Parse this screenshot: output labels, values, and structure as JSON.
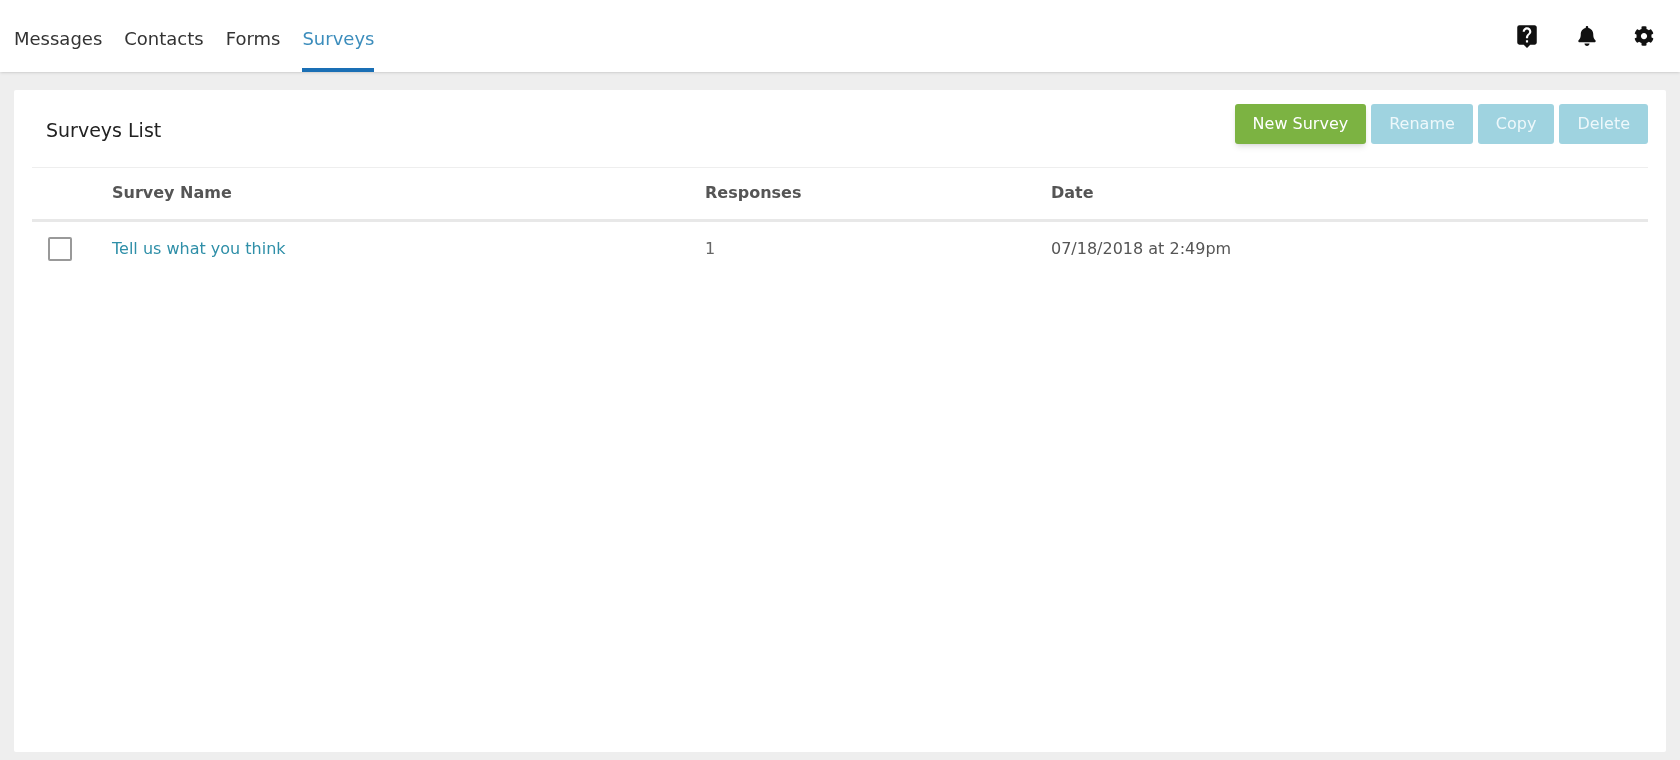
{
  "nav": {
    "tabs": [
      {
        "label": "Messages",
        "selected": false
      },
      {
        "label": "Contacts",
        "selected": false
      },
      {
        "label": "Forms",
        "selected": false
      },
      {
        "label": "Surveys",
        "selected": true
      }
    ]
  },
  "toolbar_icons": [
    {
      "kind": "help"
    },
    {
      "kind": "bell"
    },
    {
      "kind": "gear"
    }
  ],
  "panel": {
    "title": "Surveys List",
    "buttons": [
      {
        "label": "New Survey",
        "kind": "primary",
        "disabled": false
      },
      {
        "label": "Rename",
        "kind": "secondary",
        "disabled": true
      },
      {
        "label": "Copy",
        "kind": "secondary",
        "disabled": true
      },
      {
        "label": "Delete",
        "kind": "secondary",
        "disabled": true
      }
    ],
    "table": {
      "columns": [
        "Survey Name",
        "Responses",
        "Date"
      ],
      "rows": [
        {
          "checked": false,
          "name": "Tell us what you think",
          "responses": "1",
          "date": "07/18/2018 at 2:49pm"
        }
      ]
    }
  }
}
